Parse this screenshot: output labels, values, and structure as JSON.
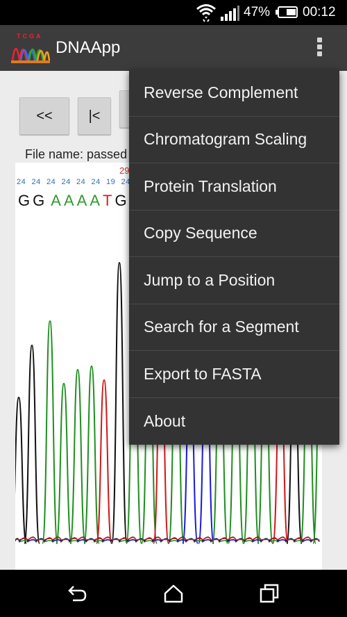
{
  "status_bar": {
    "battery_percent": "47%",
    "time": "00:12",
    "icons": [
      "wifi-icon",
      "signal-icon",
      "battery-icon"
    ]
  },
  "app_bar": {
    "title": "DNAApp",
    "logo_letters": "TCGA",
    "menu_icon": "overflow-menu-icon"
  },
  "toolbar": {
    "first_label": "<<",
    "prev_label": "|<"
  },
  "file": {
    "label": "File name: passed"
  },
  "chromatogram": {
    "position_number": "29",
    "quality_values": [
      "24",
      "24",
      "24",
      "24",
      "24",
      "24",
      "19",
      "24"
    ],
    "bases": [
      {
        "char": "G",
        "color": "#111111"
      },
      {
        "char": "G",
        "color": "#111111"
      },
      {
        "char": "A",
        "color": "#2e9b2e"
      },
      {
        "char": "A",
        "color": "#2e9b2e"
      },
      {
        "char": "A",
        "color": "#2e9b2e"
      },
      {
        "char": "A",
        "color": "#2e9b2e"
      },
      {
        "char": "T",
        "color": "#d22020"
      },
      {
        "char": "G",
        "color": "#111111"
      }
    ],
    "trace_colors": {
      "A": "#1f8f1f",
      "C": "#1a1adc",
      "G": "#111111",
      "T": "#d01818"
    }
  },
  "menu": {
    "items": [
      {
        "label": "Reverse Complement"
      },
      {
        "label": "Chromatogram Scaling"
      },
      {
        "label": "Protein Translation"
      },
      {
        "label": "Copy Sequence"
      },
      {
        "label": "Jump to a Position"
      },
      {
        "label": "Search for a Segment"
      },
      {
        "label": "Export to FASTA"
      },
      {
        "label": "About"
      }
    ]
  },
  "nav_bar": {
    "icons": [
      "back-icon",
      "home-icon",
      "recents-icon"
    ]
  }
}
